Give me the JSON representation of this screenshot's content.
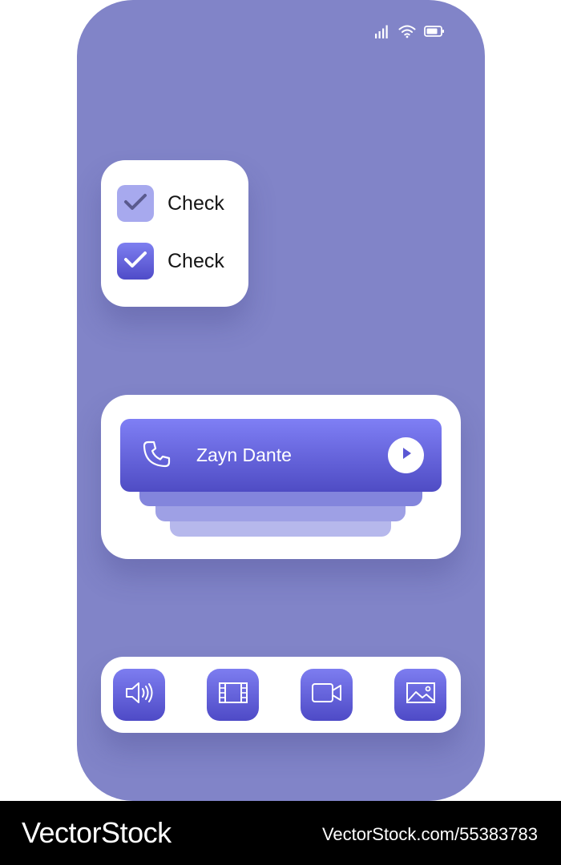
{
  "status_bar": {
    "icons": [
      "signal-icon",
      "wifi-icon",
      "battery-icon"
    ]
  },
  "check_list": {
    "items": [
      {
        "label": "Check",
        "style": "soft"
      },
      {
        "label": "Check",
        "style": "strong"
      }
    ]
  },
  "call_widget": {
    "caller_name": "Zayn Dante",
    "icons": [
      "phone-icon",
      "play-icon"
    ]
  },
  "dock": {
    "icons": [
      "speaker-icon",
      "film-icon",
      "video-camera-icon",
      "image-icon"
    ]
  },
  "watermark": {
    "brand": "VectorStock",
    "image_id": "VectorStock.com/55383783"
  },
  "colors": {
    "phone_background": "#8184c8",
    "accent_start": "#7f7ff5",
    "accent_end": "#4f4cc4",
    "checkbox_soft": "#a7a9ee",
    "card": "#ffffff",
    "footer": "#000000"
  }
}
